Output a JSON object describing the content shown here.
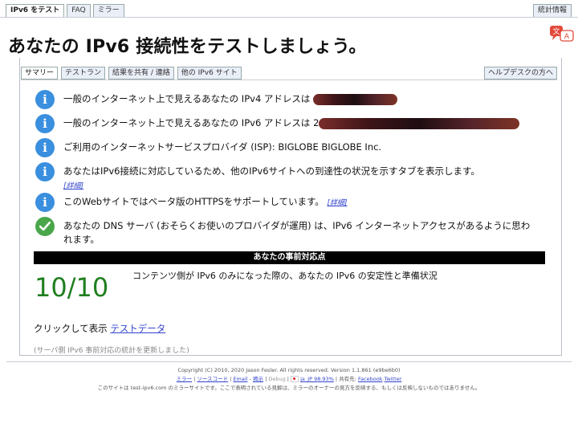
{
  "top_tabs": [
    "IPv6 をテスト",
    "FAQ",
    "ミラー"
  ],
  "stats_tab": "統計情報",
  "title": "あなたの IPv6 接続性をテストしましょう。",
  "panel_tabs": [
    "サマリー",
    "テストラン",
    "結果を共有 / 連絡",
    "他の IPv6 サイト"
  ],
  "help_tab": "ヘルプデスクの方へ",
  "rows": {
    "ipv4": "一般のインターネット上で見えるあなたの IPv4 アドレスは",
    "ipv6": "一般のインターネット上で見えるあなたの IPv6 アドレスは 2",
    "isp": "ご利用のインターネットサービスプロバイダ (ISP): BIGLOBE BIGLOBE Inc.",
    "tabs_info": "あなたはIPv6接続に対応しているため、他のIPv6サイトへの到達性の状況を示すタブを表示します。",
    "tabs_info_link": "[詳細]",
    "https": "このWebサイトではベータ版のHTTPSをサポートしています。",
    "https_link": "[詳細]",
    "dns": "あなたの DNS サーバ (おそらくお使いのプロバイダが運用) は、IPv6 インターネットアクセスがあるように思われます。"
  },
  "readiness": {
    "heading": "あなたの事前対応点",
    "score": "10/10",
    "description": "コンテンツ側が IPv6 のみになった際の、あなたの IPv6 の安定性と準備状況"
  },
  "click_prefix": "クリックして表示",
  "test_data_link": "テストデータ",
  "refresh_note": "(サーバ側 IPv6 事前対応の統計を更新しました)",
  "footer": {
    "copyright": "Copyright (C) 2010, 2020 Jason Fesler. All rights reserved. Version 1.1.861 (e9be6b0)",
    "links": [
      "ミラー",
      "ソースコード",
      "Email",
      "-",
      "揭示",
      "Debug",
      "ja_JP 98.93%",
      "共有先:",
      "Facebook",
      "Twitter"
    ],
    "mirror_note": "このサイトは test-ipv6.com のミラーサイトです。ここで表明されている見解は、ミラーのオーナーの見方を反映する、もしくは反映しないものではありません。"
  },
  "colors": {
    "info_icon": "#3a8fde",
    "ok_icon": "#4aa64a",
    "score": "#1f7f1f",
    "link": "#3344cc"
  }
}
